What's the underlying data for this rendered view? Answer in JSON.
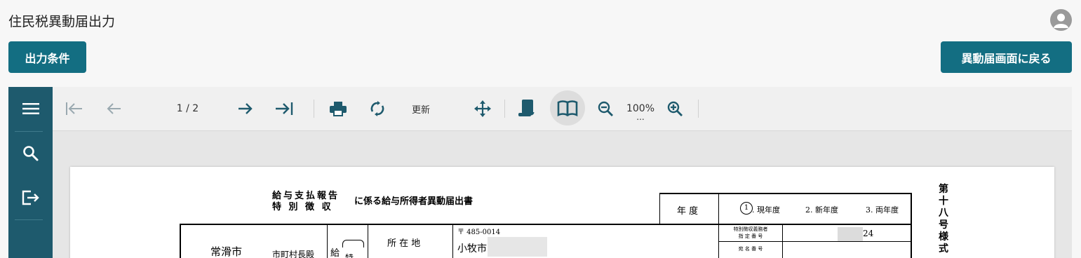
{
  "header": {
    "title": "住民税異動届出力"
  },
  "buttons": {
    "conditions": "出力条件",
    "back": "異動届画面に戻る"
  },
  "toolbar": {
    "page_indicator": "1 / 2",
    "refresh_label": "更新",
    "zoom": "100%",
    "zoom_more": "..."
  },
  "document": {
    "title_top": "給与支払報告",
    "title_bottom": "特 別 徴 収",
    "title_suffix": "に係る給与所得者異動届出書",
    "year_label": "年 度",
    "year_option_1_num": "1",
    "year_option_1": ". 現年度",
    "year_option_2": "2. 新年度",
    "year_option_3": "3. 両年度",
    "form_number": "第十八号様式",
    "city": "常滑市",
    "mayor": "市町村長殿",
    "kyu": "給",
    "toku": "特",
    "location_label": "所 在 地",
    "postal": "〒 485-0014",
    "address": "小牧市",
    "obligor_label_1": "特別徴収義務者",
    "obligor_label_2": "指 定 番 号",
    "obligor_value": "24",
    "addressee_label": "宛 名 番 号"
  }
}
